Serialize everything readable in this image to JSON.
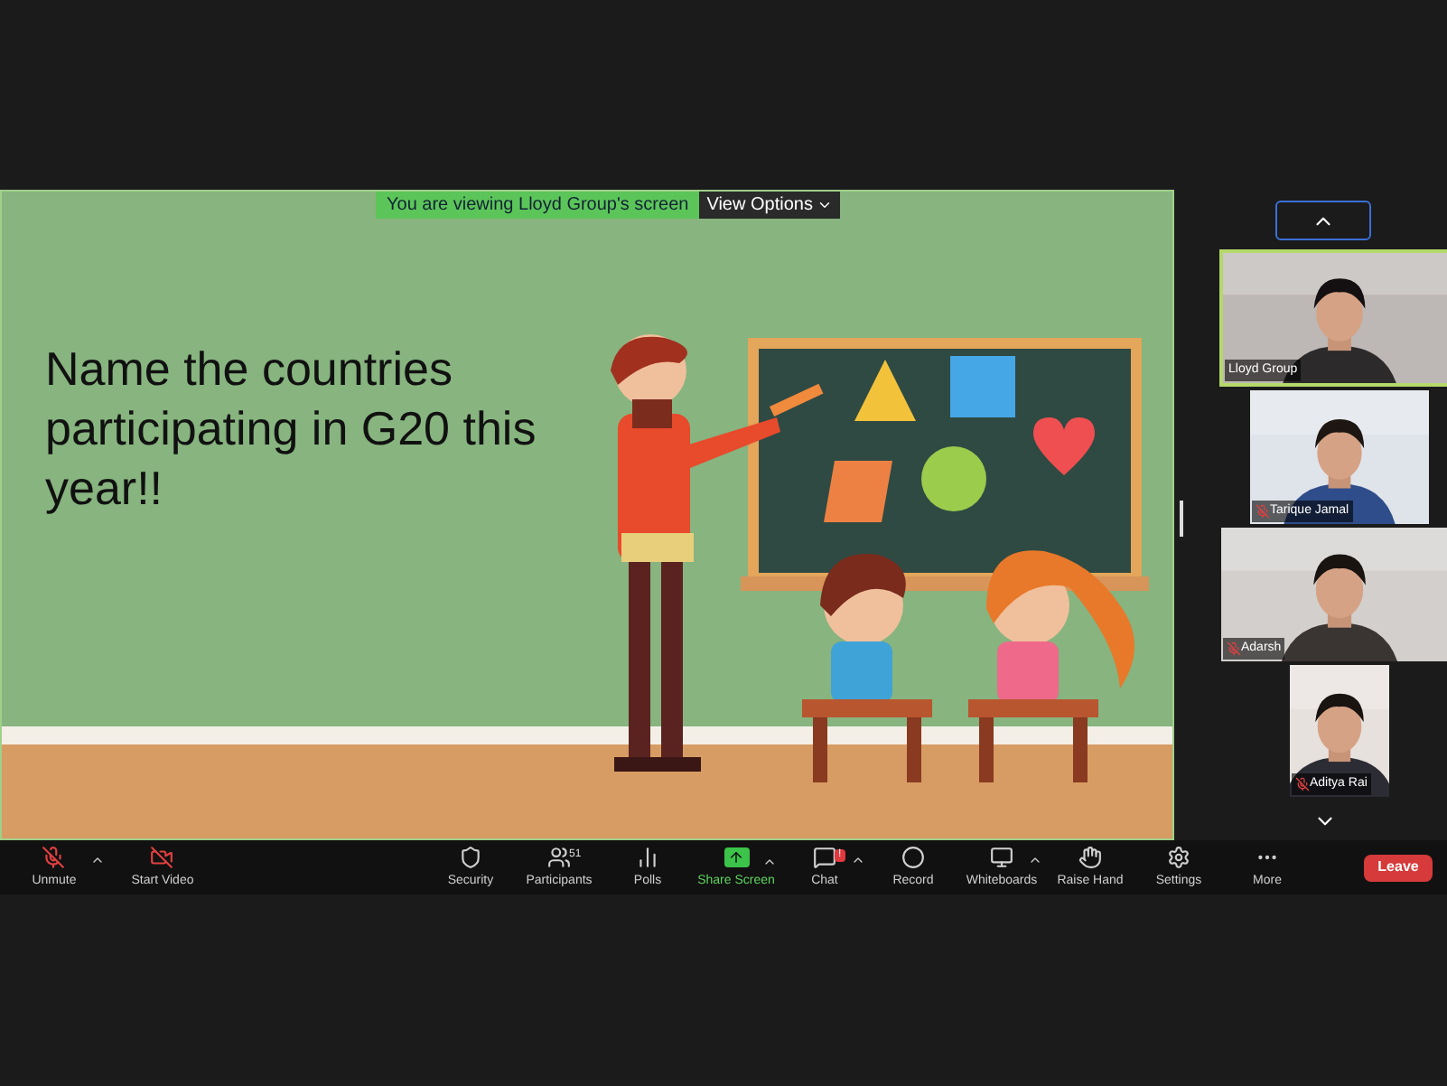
{
  "banner": {
    "text": "You are viewing Lloyd Group's screen",
    "view_options": "View Options"
  },
  "slide": {
    "text": "Name the countries participating in G20 this year!!"
  },
  "tiles": [
    {
      "name": "Lloyd Group",
      "muted": false,
      "active": true
    },
    {
      "name": "Tarique Jamal",
      "muted": true,
      "active": false
    },
    {
      "name": "Adarsh",
      "muted": true,
      "active": false
    },
    {
      "name": "Aditya Rai",
      "muted": true,
      "active": false
    }
  ],
  "toolbar": [
    {
      "label": "Unmute",
      "caret": true,
      "highlighted": false
    },
    {
      "label": "Start Video",
      "caret": false,
      "highlighted": false
    },
    {
      "label": "Security",
      "caret": false,
      "highlighted": false
    },
    {
      "label": "Participants",
      "caret": false,
      "highlighted": false,
      "badge": "51"
    },
    {
      "label": "Polls",
      "caret": false,
      "highlighted": false
    },
    {
      "label": "Share Screen",
      "caret": true,
      "highlighted": true
    },
    {
      "label": "Chat",
      "caret": true,
      "highlighted": false,
      "badge": "!"
    },
    {
      "label": "Record",
      "caret": false,
      "highlighted": false
    },
    {
      "label": "Whiteboards",
      "caret": true,
      "highlighted": false
    },
    {
      "label": "Raise Hand",
      "caret": false,
      "highlighted": false
    },
    {
      "label": "Settings",
      "caret": false,
      "highlighted": false
    },
    {
      "label": "More",
      "caret": false,
      "highlighted": false
    }
  ],
  "leave": "Leave"
}
